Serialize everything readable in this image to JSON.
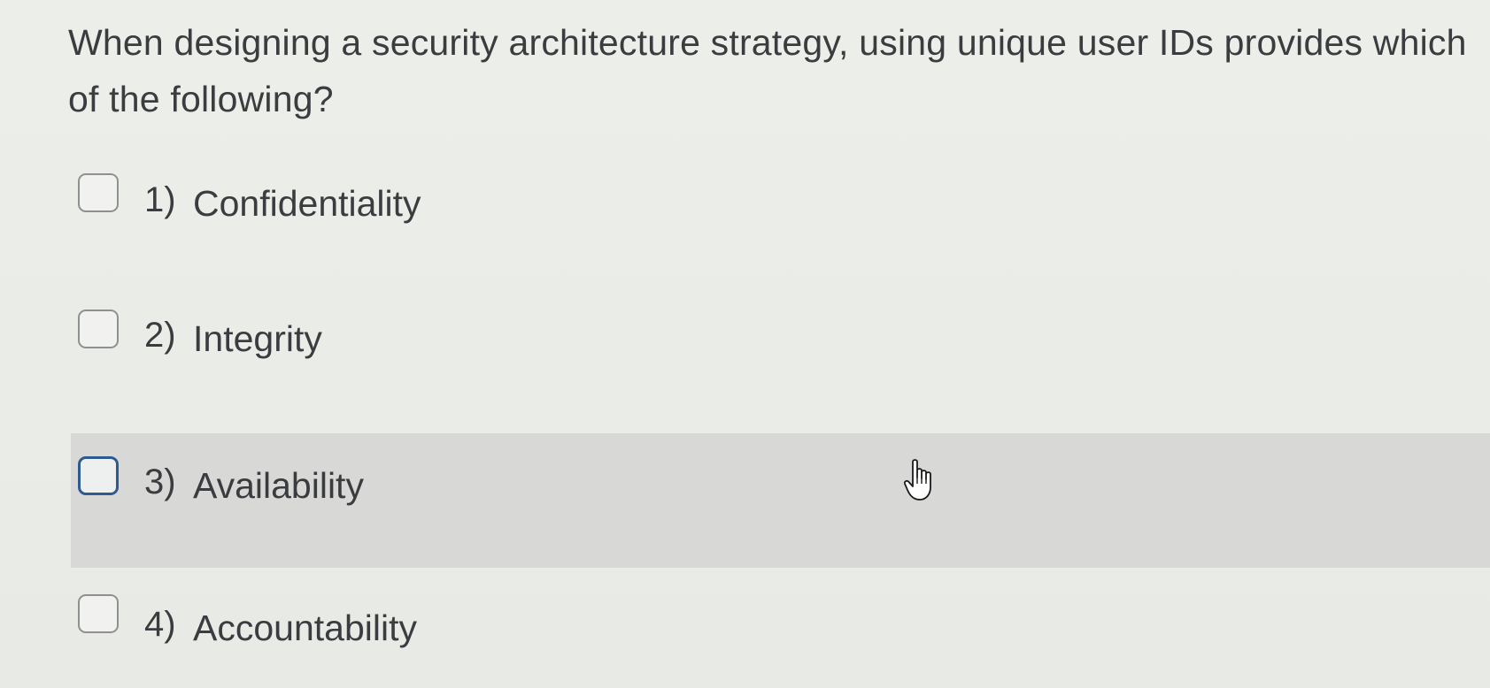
{
  "question": {
    "text": "When designing a security architecture strategy, using unique user IDs provides which of the following?"
  },
  "options": [
    {
      "number": "1)",
      "label": "Confidentiality",
      "selected": false,
      "hovered": false
    },
    {
      "number": "2)",
      "label": "Integrity",
      "selected": false,
      "hovered": false
    },
    {
      "number": "3)",
      "label": "Availability",
      "selected": false,
      "hovered": true
    },
    {
      "number": "4)",
      "label": "Accountability",
      "selected": false,
      "hovered": false
    }
  ],
  "cursor": {
    "icon": "hand-pointer-icon"
  },
  "colors": {
    "background": "#eceee9",
    "hover_row": "#d8d9d6",
    "focus_border": "#2e5a90",
    "text": "#3b3c40"
  }
}
